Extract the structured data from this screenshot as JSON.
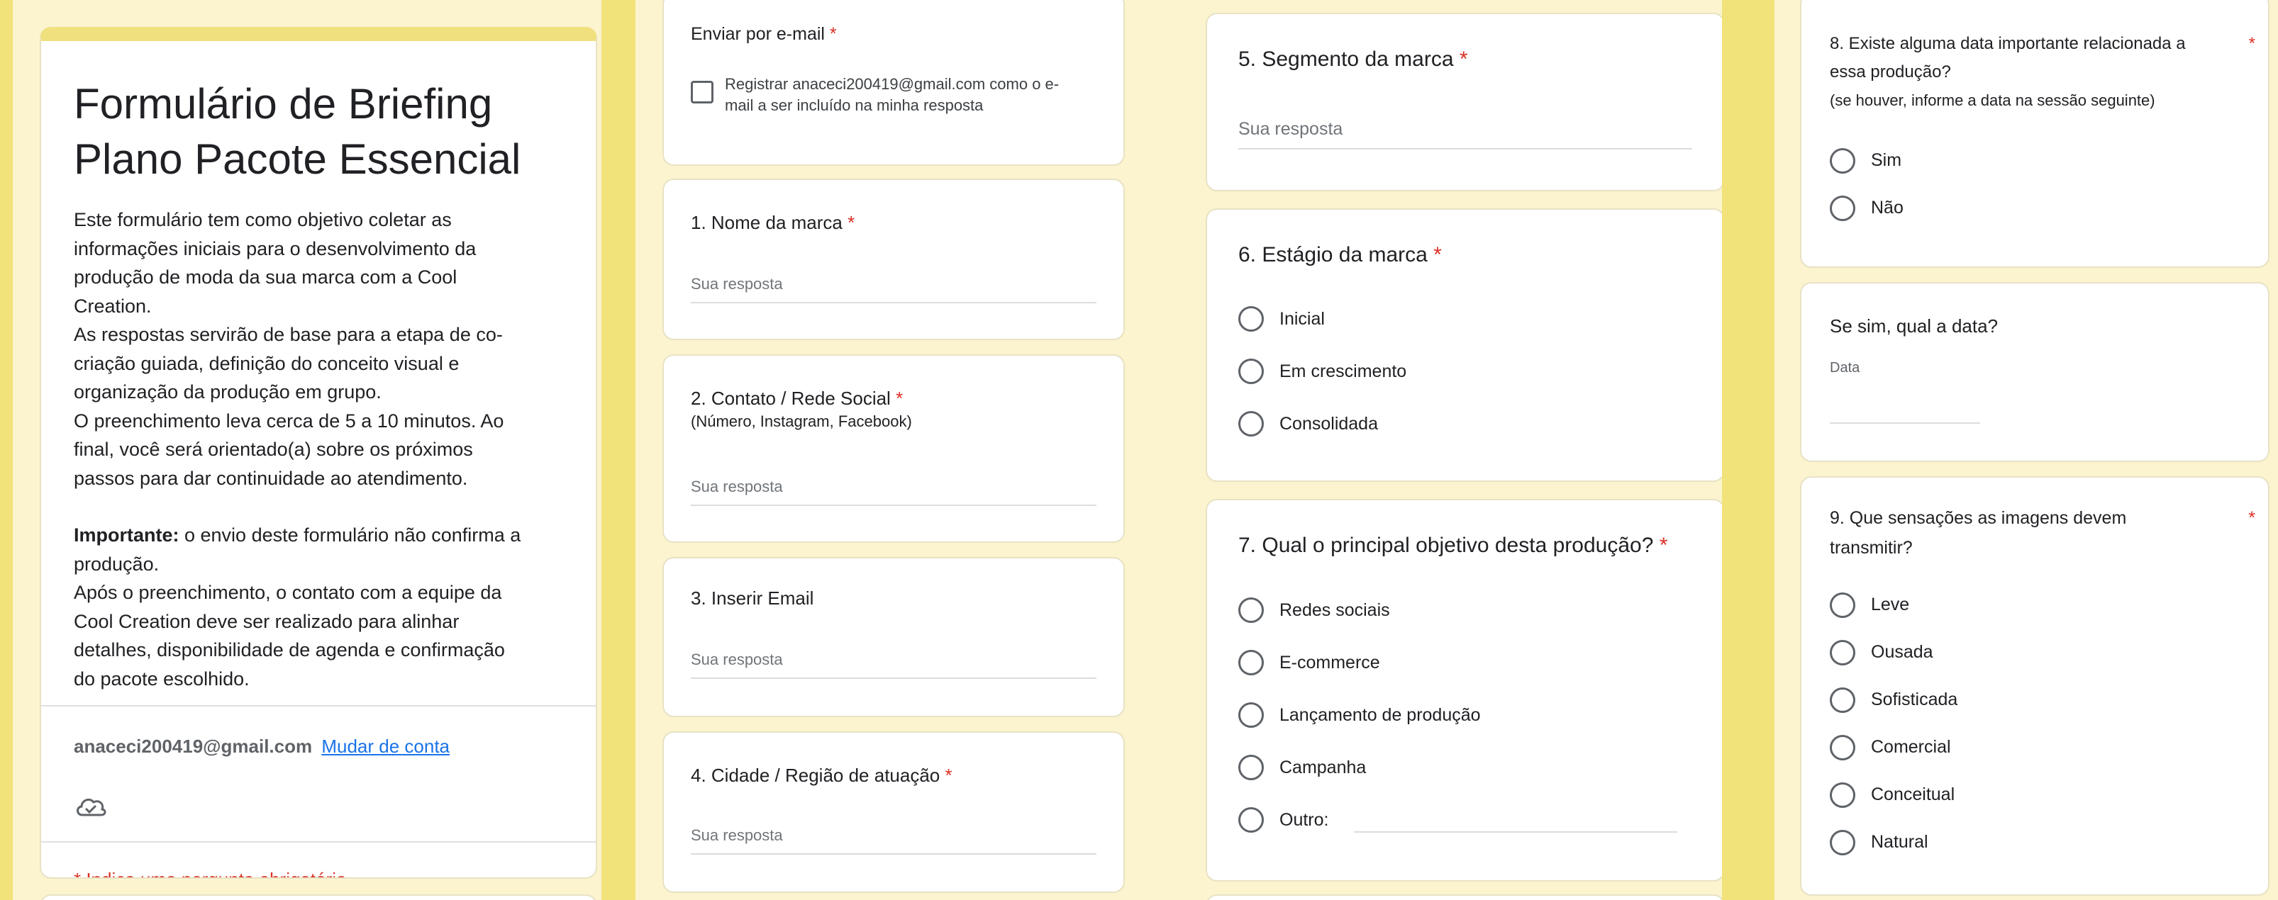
{
  "header": {
    "title_line1": "Formulário de Briefing",
    "title_line2": "Plano Pacote Essencial",
    "description_lines": [
      "Este formulário tem como objetivo coletar as",
      "informações iniciais para o desenvolvimento da",
      "produção de moda da sua marca com a Cool",
      "Creation.",
      "As respostas servirão de base para a etapa de co-",
      "criação guiada, definição do conceito visual e",
      "organização da produção em grupo.",
      "O preenchimento leva cerca de 5 a 10 minutos. Ao",
      "final, você será orientado(a) sobre os próximos",
      "passos para dar continuidade ao atendimento."
    ],
    "important_label": "Importante:",
    "important_text_line1": " o envio deste formulário não confirma a",
    "important_lines": [
      "produção.",
      "Após o preenchimento, o contato com a equipe da",
      "Cool Creation deve ser realizado para alinhar",
      "detalhes, disponibilidade de agenda e confirmação",
      "do pacote escolhido."
    ],
    "account_email": "anaceci200419@gmail.com",
    "switch_account": "Mudar de conta",
    "required_note": "* Indica uma pergunta obrigatória"
  },
  "email_section": {
    "label": "Enviar por e-mail",
    "checkbox_line1": "Registrar anaceci200419@gmail.com como o e-",
    "checkbox_line2": "mail a ser incluído na minha resposta"
  },
  "placeholder": "Sua resposta",
  "questions": {
    "q1": "1. Nome da marca",
    "q2": "2. Contato / Rede Social",
    "q2_sub": "(Número, Instagram, Facebook)",
    "q3": "3. Inserir Email",
    "q4": "4. Cidade / Região de atuação",
    "q5": "5. Segmento da marca",
    "q6": "6. Estágio da marca",
    "q6_options": [
      "Inicial",
      "Em crescimento",
      "Consolidada"
    ],
    "q7": "7. Qual o principal objetivo desta produção?",
    "q7_options": [
      "Redes sociais",
      "E-commerce",
      "Lançamento de produção",
      "Campanha",
      "Outro:"
    ],
    "q8_line1": "8. Existe alguma data importante relacionada a",
    "q8_line2": "essa produção?",
    "q8_sub": "(se houver, informe a data na sessão seguinte)",
    "q8_options": [
      "Sim",
      "Não"
    ],
    "date_title": "Se sim, qual a data?",
    "date_label": "Data",
    "q9_line1": "9. Que sensações as imagens devem",
    "q9_line2": "transmitir?",
    "q9_options": [
      "Leve",
      "Ousada",
      "Sofisticada",
      "Comercial",
      "Conceitual",
      "Natural"
    ]
  },
  "required_mark": "*",
  "colors": {
    "background": "#f2e27a",
    "panel": "#fbf4cf",
    "required": "#d93025",
    "link": "#1a73e8"
  }
}
